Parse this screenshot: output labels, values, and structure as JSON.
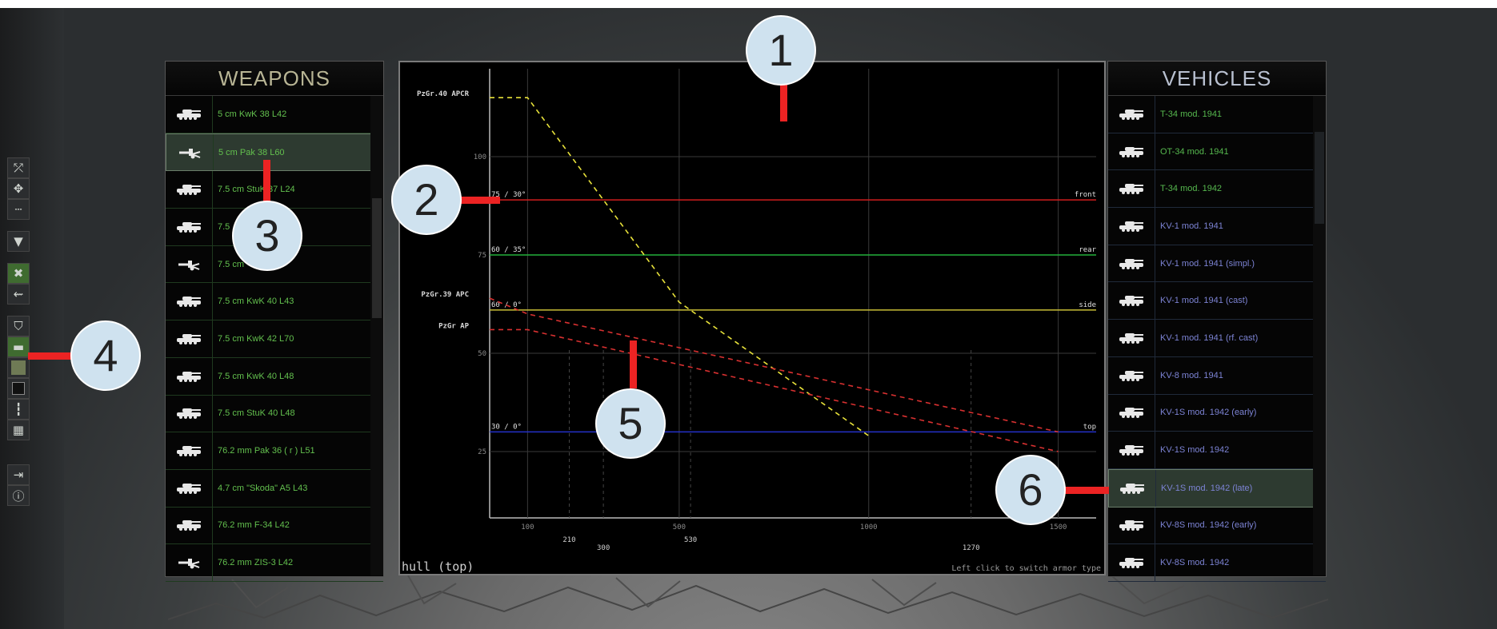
{
  "weapons": {
    "title": "WEAPONS",
    "items": [
      {
        "label": "5 cm KwK 38 L42",
        "icon": "tank-icon"
      },
      {
        "label": "5 cm Pak 38 L60",
        "icon": "antitank-gun-icon",
        "selected": true
      },
      {
        "label": "7.5 cm StuK 37 L24",
        "icon": "tank-icon"
      },
      {
        "label": "7.5",
        "icon": "tank-icon"
      },
      {
        "label": "7.5 cm",
        "icon": "antitank-gun-icon"
      },
      {
        "label": "7.5 cm KwK 40 L43",
        "icon": "tank-icon"
      },
      {
        "label": "7.5 cm KwK 42 L70",
        "icon": "tank-icon"
      },
      {
        "label": "7.5 cm KwK 40 L48",
        "icon": "tank-icon"
      },
      {
        "label": "7.5 cm StuK 40 L48",
        "icon": "tank-icon"
      },
      {
        "label": "76.2 mm Pak 36 ( r ) L51",
        "icon": "tank-icon"
      },
      {
        "label": "4.7 cm \"Skoda\" A5 L43",
        "icon": "tank-icon"
      },
      {
        "label": "76.2 mm F-34 L42",
        "icon": "tank-icon"
      },
      {
        "label": "76.2 mm ZIS-3 L42",
        "icon": "antitank-gun-icon"
      }
    ]
  },
  "vehicles": {
    "title": "VEHICLES",
    "items": [
      {
        "label": "T-34 mod. 1941",
        "color": "green"
      },
      {
        "label": "OT-34 mod. 1941",
        "color": "green"
      },
      {
        "label": "T-34 mod. 1942",
        "color": "green"
      },
      {
        "label": "KV-1 mod. 1941",
        "color": "blue"
      },
      {
        "label": "KV-1 mod. 1941 (simpl.)",
        "color": "blue"
      },
      {
        "label": "KV-1 mod. 1941 (cast)",
        "color": "blue"
      },
      {
        "label": "KV-1 mod. 1941 (rf. cast)",
        "color": "blue"
      },
      {
        "label": "KV-8 mod. 1941",
        "color": "blue"
      },
      {
        "label": "KV-1S mod. 1942 (early)",
        "color": "blue"
      },
      {
        "label": "KV-1S mod. 1942",
        "color": "blue"
      },
      {
        "label": "KV-1S mod. 1942 (late)",
        "color": "blue",
        "selected": true
      },
      {
        "label": "KV-8S mod. 1942 (early)",
        "color": "blue"
      },
      {
        "label": "KV-8S mod. 1942",
        "color": "blue"
      }
    ]
  },
  "chart": {
    "armor_type_label": "hull (top)",
    "hint": "Left click to switch armor type"
  },
  "chart_data": {
    "type": "line",
    "title": "",
    "xlabel": "",
    "ylabel": "",
    "xlim": [
      0,
      1600
    ],
    "ylim": [
      0,
      100
    ],
    "x_ticks": [
      100,
      500,
      1000,
      1500
    ],
    "x_ticks_secondary": [
      210,
      300,
      530,
      1270
    ],
    "y_ticks": [
      25,
      50,
      75,
      100
    ],
    "series": [
      {
        "name": "PzGr.40 APCR",
        "style": "dashed",
        "color": "#e8e23a",
        "x": [
          0,
          100,
          500,
          1000
        ],
        "y": [
          115,
          115,
          63,
          29
        ]
      },
      {
        "name": "PzGr.39 APC",
        "style": "dashed",
        "color": "#d83030",
        "x": [
          0,
          100,
          1500
        ],
        "y": [
          64,
          60,
          30
        ]
      },
      {
        "name": "PzGr AP",
        "style": "dashed",
        "color": "#d83030",
        "x": [
          0,
          100,
          1500
        ],
        "y": [
          56,
          56,
          25
        ]
      }
    ],
    "armor_lines": [
      {
        "label": "75 / 30°",
        "side": "front",
        "value": 89,
        "color": "#d01e1e"
      },
      {
        "label": "60 / 35°",
        "side": "rear",
        "value": 75,
        "color": "#22b03a"
      },
      {
        "label": "60 / 0°",
        "side": "side",
        "value": 61,
        "color": "#c8bd36"
      },
      {
        "label": "30 / 0°",
        "side": "top",
        "value": 30,
        "color": "#2430c8"
      }
    ]
  },
  "callouts": [
    "1",
    "2",
    "3",
    "4",
    "5",
    "6"
  ],
  "toolbar": {
    "icons": [
      "waypoint-icon",
      "move-icon",
      "dotted-line-icon",
      "filter-icon",
      "close-icon",
      "weapon-fire-icon",
      "armor-shield-icon",
      "tank-icon",
      "terrain-square-icon",
      "dark-square-icon",
      "ruler-icon",
      "map-icon",
      "exit-icon",
      "info-icon"
    ],
    "active": [
      "close-icon",
      "tank-icon"
    ]
  }
}
